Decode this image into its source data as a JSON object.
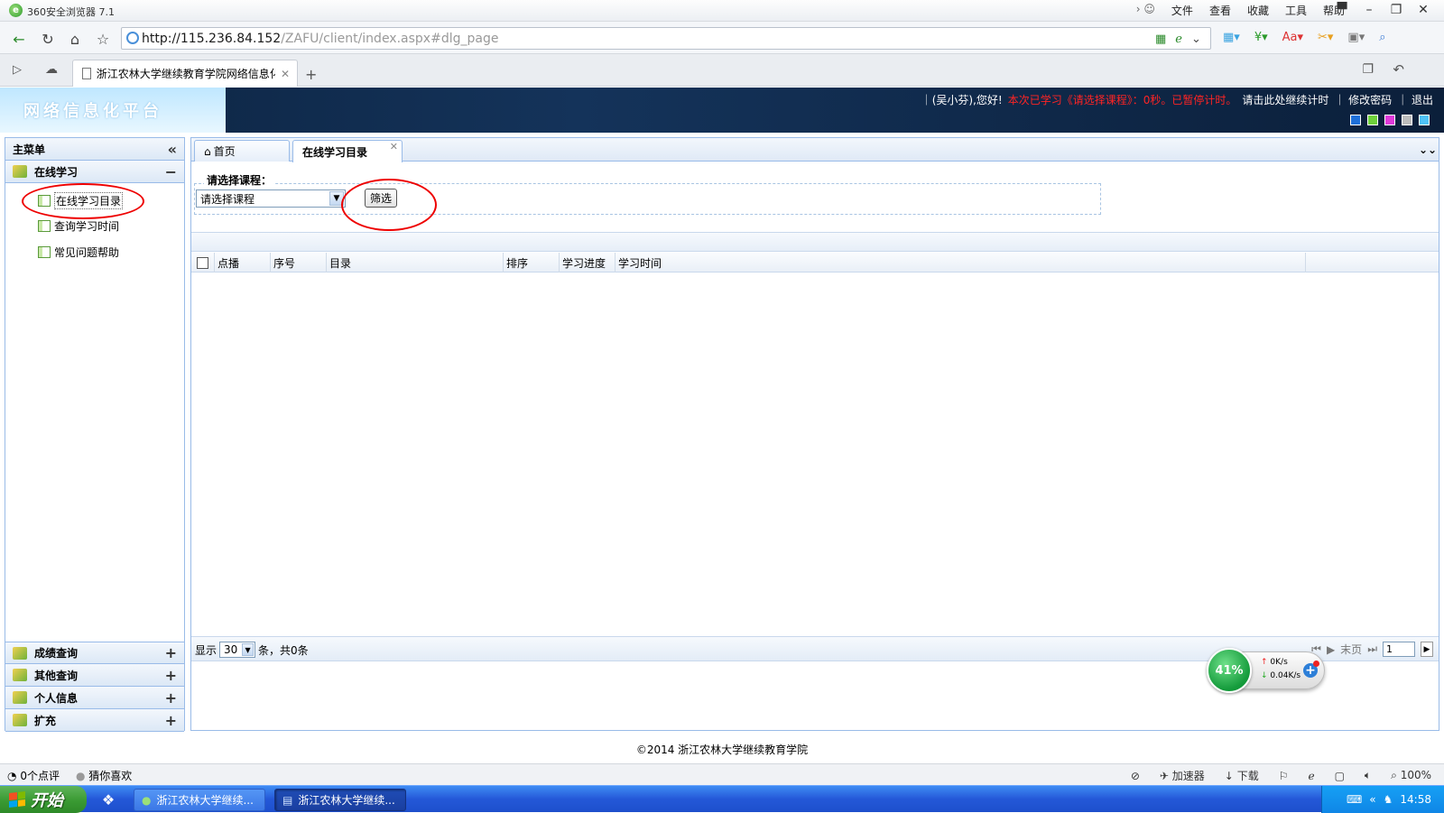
{
  "browser": {
    "app_title": "360安全浏览器 7.1",
    "menu": [
      "文件",
      "查看",
      "收藏",
      "工具",
      "帮助"
    ],
    "url_host": "http://115.236.84.152",
    "url_path": "/ZAFU/client/index.aspx#dlg_page",
    "tab_title": "浙江农林大学继续教育学院网络信息化",
    "new_tab": "+"
  },
  "header": {
    "brand": "网络信息化平台",
    "greeting": "｜(吴小芬),您好!",
    "warning": "本次已学习《请选择课程》：0秒。已暂停计时。",
    "resume_link": "请击此处继续计时",
    "change_password": "｜ 修改密码",
    "logout": "｜ 退出",
    "theme_colors": [
      "#1e6fd9",
      "#6fd13b",
      "#e03ad9",
      "#bdbdbd",
      "#4fc3f7"
    ]
  },
  "sidebar": {
    "title": "主菜单",
    "online_section": "在线学习",
    "items": [
      "在线学习目录",
      "查询学习时间",
      "常见问题帮助"
    ],
    "sections": [
      "成绩查询",
      "其他查询",
      "个人信息",
      "扩充"
    ]
  },
  "content": {
    "tabs": [
      "首页",
      "在线学习目录"
    ],
    "filter_legend": "请选择课程：",
    "select_value": "请选择课程",
    "filter_button": "筛选",
    "columns": [
      "点播",
      "序号",
      "目录",
      "排序",
      "学习进度",
      "学习时间"
    ],
    "pager": {
      "show_label": "显示",
      "page_size": "30",
      "count_label": "条，共0条",
      "last_label": "末页",
      "page_value": "1"
    }
  },
  "speed_widget": {
    "percent": "41%",
    "up": "0K/s",
    "down": "0.04K/s"
  },
  "copyright": "©2014 浙江农林大学继续教育学院",
  "statusbar": {
    "left": [
      "0个点评",
      "猜你喜欢"
    ],
    "accelerator": "加速器",
    "download": "下载",
    "zoom": "100%"
  },
  "taskbar": {
    "start": "开始",
    "tasks": [
      "浙江农林大学继续...",
      "浙江农林大学继续..."
    ],
    "clock": "14:58"
  }
}
